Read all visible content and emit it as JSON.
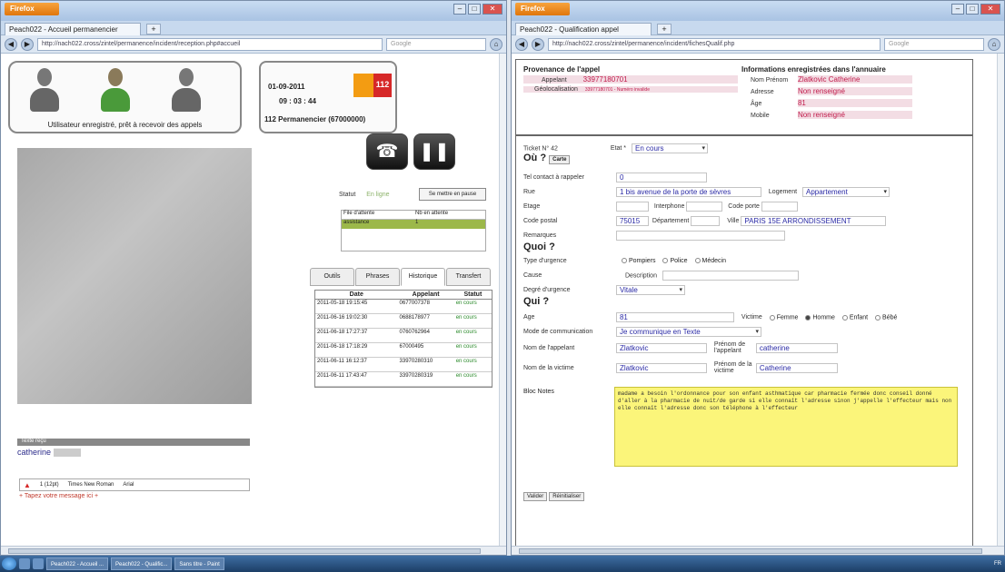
{
  "left_window": {
    "brand": "Firefox",
    "tab_title": "Peach022 - Accueil permanencier",
    "url": "http://nach022.cross/zintel/permanence/incident/reception.php#accueil",
    "search_placeholder": "Google",
    "user_caption": "Utilisateur enregistré, prêt à recevoir des appels",
    "date": "01-09-2011",
    "time": "09 : 03 : 44",
    "operator": "112 Permanencier (67000000)",
    "logo_text": "112",
    "status_label": "Statut",
    "status_value": "En ligne",
    "pause_button": "Se mettre en pause",
    "queue_headers": [
      "File d'attente",
      "Nb en attente"
    ],
    "queue_row": [
      "assistance",
      "1"
    ],
    "tabs": [
      "Outils",
      "Phrases",
      "Historique",
      "Transfert"
    ],
    "history_headers": [
      "Date",
      "Appelant",
      "Statut"
    ],
    "history_rows": [
      {
        "date": "2011-05-18 19:15:45",
        "caller": "0677007378",
        "status": "en cours"
      },
      {
        "date": "2011-06-16 19:02:30",
        "caller": "0688178977",
        "status": "en cours"
      },
      {
        "date": "2011-06-18 17:27:37",
        "caller": "0760762964",
        "status": "en cours"
      },
      {
        "date": "2011-06-18 17:18:29",
        "caller": "67000495",
        "status": "en cours"
      },
      {
        "date": "2011-06-11 16:12:37",
        "caller": "33970280310",
        "status": "en cours"
      },
      {
        "date": "2011-06-11 17:43:47",
        "caller": "33970280319",
        "status": "en cours"
      }
    ],
    "messages_header": "Texte reçu",
    "message_user": "catherine",
    "msg_tools": [
      "1 (12pt)",
      "Times New Roman",
      "Arial"
    ],
    "msg_placeholder": "+ Tapez votre message ici +"
  },
  "right_window": {
    "brand": "Firefox",
    "tab_title": "Peach022 - Qualification appel",
    "url": "http://nach022.cross/zintel/permanence/incident/fichesQualif.php",
    "search_placeholder": "Google",
    "provenance": {
      "title": "Provenance de l'appel",
      "appelant_label": "Appelant",
      "appelant_value": "33977180701",
      "geo_label": "Géolocalisation",
      "geo_value": "33977180701 - Numéro invalide"
    },
    "annuaire": {
      "title": "Informations enregistrées dans l'annuaire",
      "nom_label": "Nom Prénom",
      "nom_value": "Zlatkovic Catherine",
      "adresse_label": "Adresse",
      "adresse_value": "Non renseigné",
      "age_label": "Âge",
      "age_value": "81",
      "mobile_label": "Mobile",
      "mobile_value": "Non renseigné"
    },
    "ticket_label": "Ticket N° 42",
    "etat_label": "Etat *",
    "etat_value": "En cours",
    "ou_title": "Où ?",
    "carte_button": "Carte",
    "tel_contact_label": "Tel contact à rappeler",
    "tel_contact_value": "0",
    "rue_label": "Rue",
    "rue_value": "1 bis avenue de la porte de sèvres",
    "logement_label": "Logement",
    "logement_value": "Appartement",
    "etage_label": "Etage",
    "interphone_label": "Interphone",
    "code_porte_label": "Code porte",
    "cp_label": "Code postal",
    "cp_value": "75015",
    "dept_label": "Département",
    "ville_label": "Ville",
    "ville_value": "PARIS 15E ARRONDISSEMENT",
    "remarques_label": "Remarques",
    "quoi_title": "Quoi ?",
    "urgence_label": "Type d'urgence",
    "urgence_options": [
      "Pompiers",
      "Police",
      "Médecin"
    ],
    "cause_label": "Cause",
    "description_label": "Description",
    "degre_label": "Degré d'urgence",
    "degre_value": "Vitale",
    "qui_title": "Qui ?",
    "age_label": "Age",
    "age_value": "81",
    "victime_label": "Victime",
    "victime_options": [
      "Femme",
      "Homme",
      "Enfant",
      "Bébé"
    ],
    "mode_label": "Mode de communication",
    "mode_value": "Je communique en Texte",
    "nom_appelant_label": "Nom de l'appelant",
    "nom_appelant_value": "Zlatkovic",
    "prenom_appelant_label": "Prénom de l'appelant",
    "prenom_appelant_value": "catherine",
    "nom_victime_label": "Nom de la victime",
    "nom_victime_value": "Zlatkovic",
    "prenom_victime_label": "Prénom de la victime",
    "prenom_victime_value": "Catherine",
    "notes_label": "Bloc Notes",
    "notes_value": "madame a besoin l'ordonnance pour son enfant asthmatique car pharmacie fermée donc conseil donné d'aller à la pharmacie de nuit/de garde si elle connaît l'adresse sinon j'appelle l'effecteur mais non elle connaît l'adresse donc son téléphone à l'effecteur",
    "valider_button": "Valider",
    "reinit_button": "Réinitialiser"
  },
  "taskbar": {
    "tasks": [
      "Peach022 - Accueil ...",
      "Peach022 - Qualific...",
      "Sans titre - Paint"
    ],
    "tray": "FR"
  }
}
